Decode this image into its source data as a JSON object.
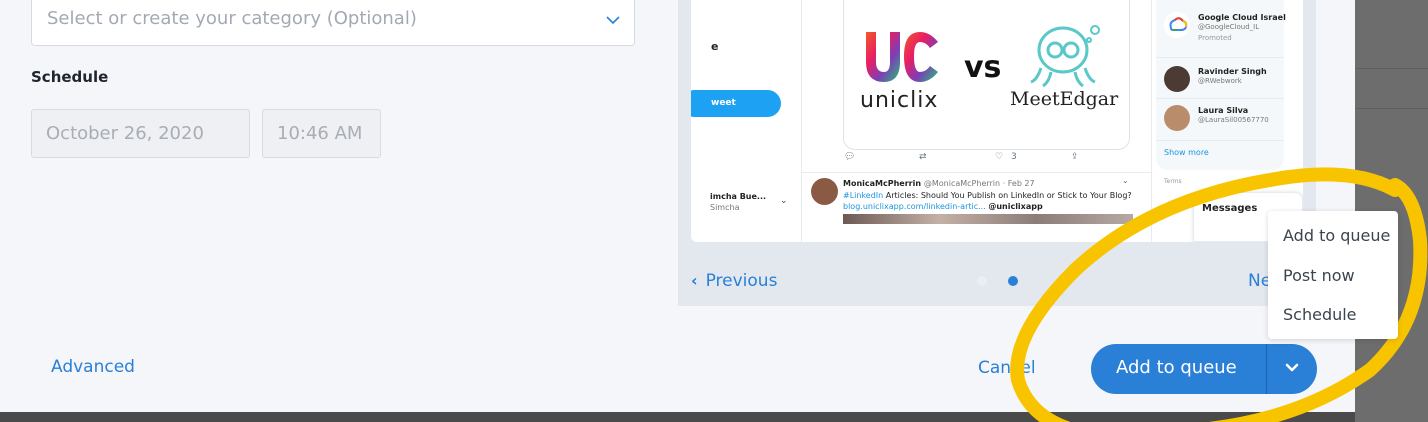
{
  "form": {
    "category_placeholder": "Select or create your category (Optional)",
    "schedule_label": "Schedule",
    "date_value": "October 26, 2020",
    "time_value": "10:46 AM",
    "advanced_label": "Advanced"
  },
  "preview": {
    "screenshot": {
      "left_letter": "e",
      "tweet_button_label": "weet",
      "user_name": "imcha Bue...",
      "user_sub": "Simcha",
      "uniclix_word": "uniclix",
      "vs_word": "vs",
      "meetedgar_word": "MeetEdgar",
      "action_like_count": "3",
      "tweet": {
        "name": "MonicaMcPherrin",
        "handle": "@MonicaMcPherrin · Feb 27",
        "hashtag": "#LinkedIn",
        "text": " Articles: Should You Publish on LinkedIn or Stick to Your Blog?",
        "link": "blog.uniclixapp.com/linkedin-artic...",
        "mention": "@uniclixapp"
      },
      "who_to_follow": [
        {
          "name": "Google Cloud Israel",
          "handle": "@GoogleCloud_IL",
          "promoted": "Promoted"
        },
        {
          "name": "Ravinder Singh",
          "handle": "@RWebwork"
        },
        {
          "name": "Laura Silva",
          "handle": "@LauraSil00567770"
        }
      ],
      "show_more": "Show more",
      "terms": "Terms",
      "messages": "Messages"
    },
    "previous_label": "Previous",
    "next_label": "Ne",
    "active_dot": 2
  },
  "footer": {
    "cancel_label": "Cancel",
    "add_to_queue_label": "Add to queue"
  },
  "dropdown": {
    "items": [
      "Add to queue",
      "Post now",
      "Schedule"
    ]
  },
  "colors": {
    "accent": "#2a7fd6",
    "highlight_marker": "#f8c400",
    "modal_bg": "#f4f6fa"
  }
}
